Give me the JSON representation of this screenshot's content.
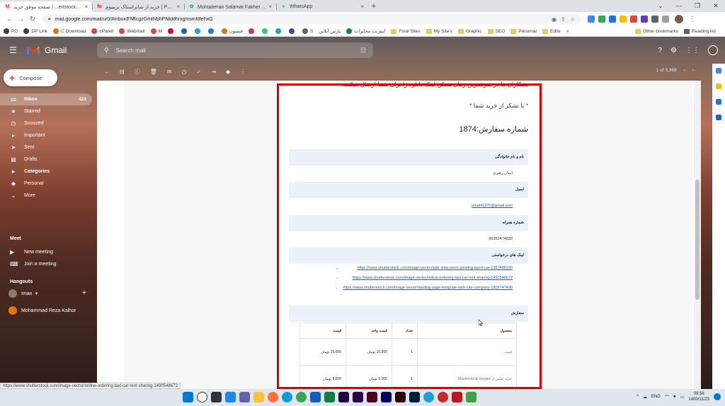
{
  "tabs": [
    {
      "label": "صفحه موفق خرید | ...ertstock |images",
      "active": true
    },
    {
      "label": "خرید از شاتراستاک پرمیوم | Premium | ...",
      "active": false
    },
    {
      "label": "Mohtaberan Salamat Fakher | معتبران",
      "active": false
    },
    {
      "label": "WhatsApp",
      "active": false
    }
  ],
  "addressbar": {
    "url": "mail.google.com/mail/u/0/#inbox/FMfcgzGmtNbhPNlddhrxgmsmhlfehxG"
  },
  "bookmarks": [
    {
      "label": "PO",
      "color": "#3c4043"
    },
    {
      "label": "DP Link",
      "color": "#3c4043"
    },
    {
      "label": "C Download",
      "color": "#e37400"
    },
    {
      "label": "cPanel",
      "color": "#ea4335"
    },
    {
      "label": "Webmail",
      "color": "#ea4335"
    },
    {
      "label": "M",
      "color": "#ea4335"
    },
    {
      "label": "فنسون",
      "color": "#e8710a"
    },
    {
      "label": "S",
      "color": "#5f6368"
    },
    {
      "label": "پارس آنلاین",
      "color": "#5f6368"
    },
    {
      "label": "اینترنت مخابرات",
      "color": "#188038"
    }
  ],
  "bookmark_folders": [
    "Final Sites",
    "My Site's",
    "Graphic",
    "SEO",
    "Personal",
    "Edite"
  ],
  "bookmark_right": [
    "Other bookmarks",
    "Reading list"
  ],
  "gmail": {
    "brand": "Gmail",
    "search_placeholder": "Search mail",
    "compose_label": "Compose",
    "nav": [
      {
        "label": "Inbox",
        "count": "422",
        "icon": "inbox-icon",
        "active": true
      },
      {
        "label": "Starred",
        "count": "",
        "icon": "star-icon",
        "active": false
      },
      {
        "label": "Snoozed",
        "count": "",
        "icon": "clock-icon",
        "active": false
      },
      {
        "label": "Important",
        "count": "",
        "icon": "label-icon",
        "active": false
      },
      {
        "label": "Sent",
        "count": "",
        "icon": "send-icon",
        "active": false
      },
      {
        "label": "Drafts",
        "count": "",
        "icon": "draft-icon",
        "active": false
      },
      {
        "label": "Categories",
        "count": "",
        "icon": "categories-icon",
        "active": false
      },
      {
        "label": "Personal",
        "count": "",
        "icon": "label-icon",
        "active": false
      },
      {
        "label": "More",
        "count": "",
        "icon": "chevron-down-icon",
        "active": false
      }
    ],
    "meet_label": "Meet",
    "meet_items": [
      "New meeting",
      "Join a meeting"
    ],
    "hangouts_label": "Hangouts",
    "hangouts_user": "Iman",
    "hangouts_contact": "Mohammad Reza Kalhor",
    "pager": "1 of 3,368"
  },
  "email": {
    "line1": "همکاران ما در سریعترین زمان ممکن لینک دانلود را برای شما ارسال میکنند.",
    "line2": "* با تشکر از خرید شما *",
    "order_number": "شماره سفارش:1874",
    "fields": [
      {
        "label": "نام و نام خانوادگی",
        "value": "ایمان رهبری"
      },
      {
        "label": "ایمیل",
        "value": "omahi1370@gmail.com"
      },
      {
        "label": "شماره همراه",
        "value": "00352474830"
      },
      {
        "label": "لینک های درخواستی",
        "value": ""
      }
    ],
    "links": [
      "https://www.shutterstock.com/image-vector/side-view-neon-glowing-sport-car-1387480190",
      "https://www.shutterstock.com/image-vector/online-ordering-taxi-car-rent-sharing-1490548672",
      "https://www.shutterstock.com/image-vector/landing-page-template-web-site-company-1809747490"
    ],
    "order_label": "سفارش",
    "table_headers": [
      "محصول",
      "تعداد",
      "قیمت واحد",
      "قیمت"
    ],
    "table_rows": [
      {
        "product": "قیمت",
        "qty": "1",
        "unit": "10,000 تومان",
        "total": "10,000 تومان"
      },
      {
        "product": "خرید عکس از Shutterstock| images",
        "qty": "1",
        "unit": "5,000 تومان",
        "total": "5,000 تومان"
      }
    ]
  },
  "status_url": "https://www.shutterstock.com/image-vector/online-ordering-taxi-car-rent-sharing-1490548672",
  "taskbar": {
    "lang": "ENG",
    "time": "09:56",
    "date": "1400/11/23"
  }
}
